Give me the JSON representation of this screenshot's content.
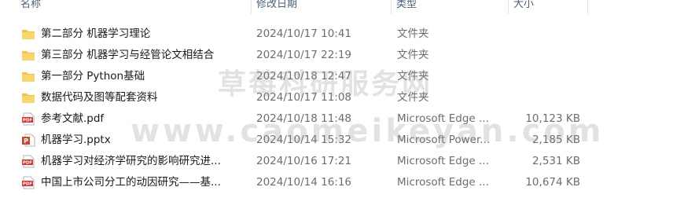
{
  "columns": {
    "name": "名称",
    "date": "修改日期",
    "type": "类型",
    "size": "大小"
  },
  "files": [
    {
      "name": "第二部分 机器学习理论",
      "date": "2024/10/17 10:41",
      "type": "文件夹",
      "size": "",
      "icon": "folder-icon"
    },
    {
      "name": "第三部分 机器学习与经管论文相结合",
      "date": "2024/10/17 22:19",
      "type": "文件夹",
      "size": "",
      "icon": "folder-icon"
    },
    {
      "name": "第一部分 Python基础",
      "date": "2024/10/18 12:47",
      "type": "文件夹",
      "size": "",
      "icon": "folder-icon"
    },
    {
      "name": "数据代码及图等配套资料",
      "date": "2024/10/17 11:08",
      "type": "文件夹",
      "size": "",
      "icon": "folder-icon"
    },
    {
      "name": "参考文献.pdf",
      "date": "2024/10/18 11:48",
      "type": "Microsoft Edge ...",
      "size": "10,123 KB",
      "icon": "pdf-icon"
    },
    {
      "name": "机器学习.pptx",
      "date": "2024/10/14 15:32",
      "type": "Microsoft Power...",
      "size": "2,185 KB",
      "icon": "pptx-icon"
    },
    {
      "name": "机器学习对经济学研究的影响研究进...",
      "date": "2024/10/16 17:21",
      "type": "Microsoft Edge ...",
      "size": "2,531 KB",
      "icon": "pdf-icon"
    },
    {
      "name": "中国上市公司分工的动因研究——基...",
      "date": "2024/10/14 16:16",
      "type": "Microsoft Edge ...",
      "size": "10,674 KB",
      "icon": "pdf-icon"
    }
  ],
  "watermark": {
    "line1": "草莓科研服务网",
    "line2": "www.caomeikeyan.com"
  },
  "colors": {
    "folder": "#f4c24b",
    "pdf": "#d9302a",
    "pptx": "#c9472a",
    "header_text": "#4c607a"
  }
}
